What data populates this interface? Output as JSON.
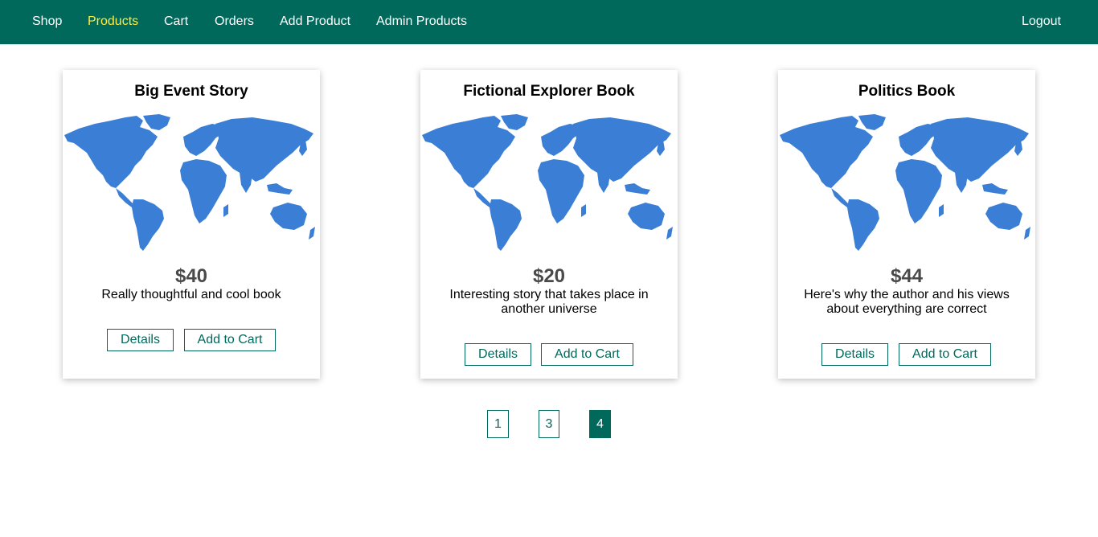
{
  "nav": {
    "items": [
      {
        "label": "Shop",
        "active": false
      },
      {
        "label": "Products",
        "active": true
      },
      {
        "label": "Cart",
        "active": false
      },
      {
        "label": "Orders",
        "active": false
      },
      {
        "label": "Add Product",
        "active": false
      },
      {
        "label": "Admin Products",
        "active": false
      }
    ],
    "logout": "Logout"
  },
  "colors": {
    "header": "#00695c",
    "active_nav": "#ffeb3b",
    "map": "#3a7fd5"
  },
  "products": [
    {
      "title": "Big Event Story",
      "price": "$40",
      "description": "Really thoughtful and cool book",
      "details_label": "Details",
      "cart_label": "Add to Cart",
      "image_icon": "world-map-icon"
    },
    {
      "title": "Fictional Explorer Book",
      "price": "$20",
      "description": "Interesting story that takes place in another universe",
      "details_label": "Details",
      "cart_label": "Add to Cart",
      "image_icon": "world-map-icon"
    },
    {
      "title": "Politics Book",
      "price": "$44",
      "description": "Here's why the author and his views about everything are correct",
      "details_label": "Details",
      "cart_label": "Add to Cart",
      "image_icon": "world-map-icon"
    }
  ],
  "pagination": {
    "pages": [
      "1",
      "3",
      "4"
    ],
    "current": "4"
  }
}
